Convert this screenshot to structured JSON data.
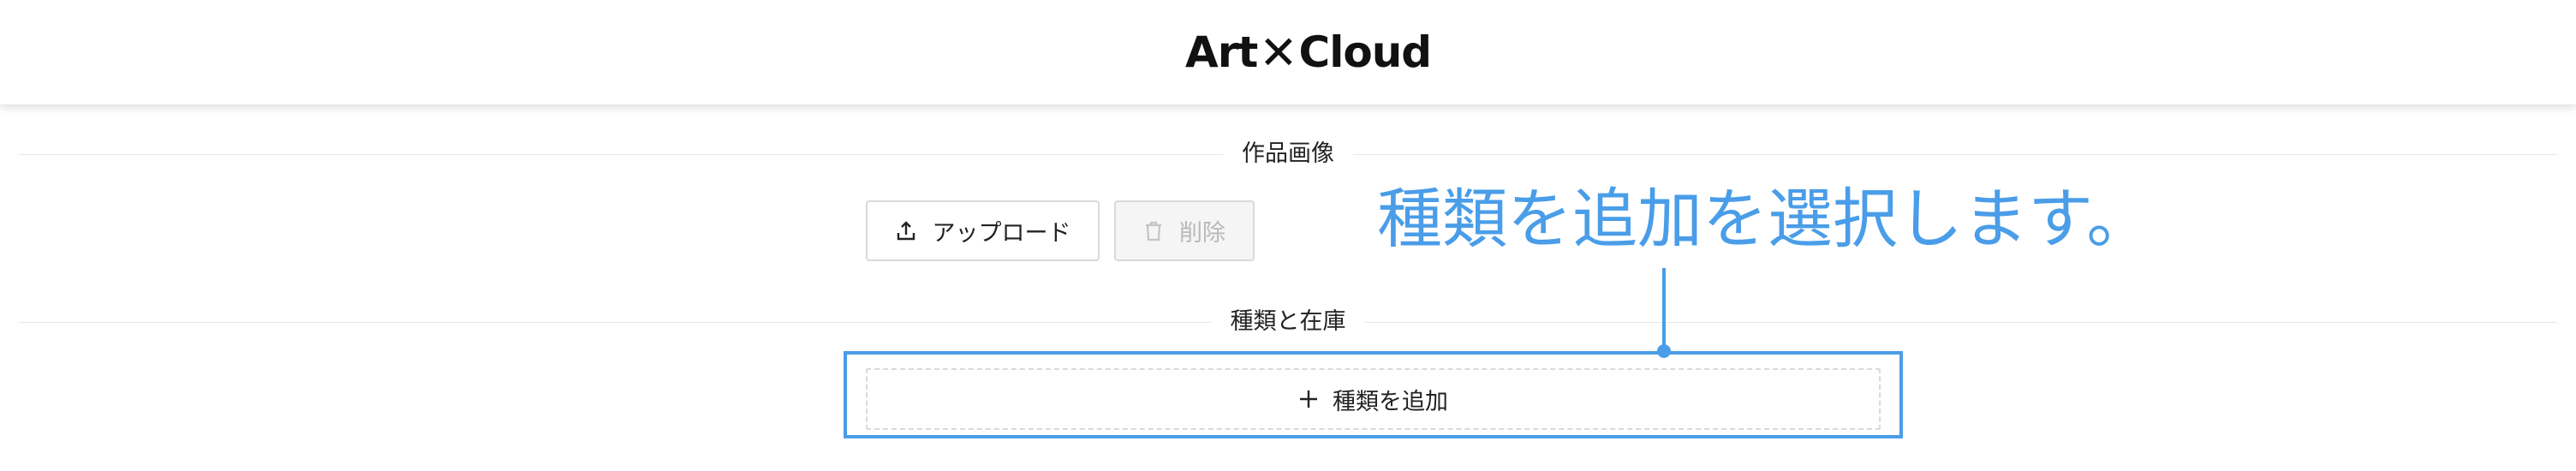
{
  "header": {
    "logo_left": "Art",
    "logo_mark": "✕",
    "logo_right": "Cloud"
  },
  "sections": {
    "images_title": "作品画像",
    "variants_title": "種類と在庫"
  },
  "buttons": {
    "upload_label": "アップロード",
    "delete_label": "削除",
    "add_variant_label": "種類を追加"
  },
  "annotation": {
    "text": "種類を追加を選択します。"
  },
  "colors": {
    "accent": "#4a9de8",
    "border": "#d9d9d9",
    "disabled_bg": "#f5f5f5",
    "disabled_text": "#b8b8b8"
  }
}
